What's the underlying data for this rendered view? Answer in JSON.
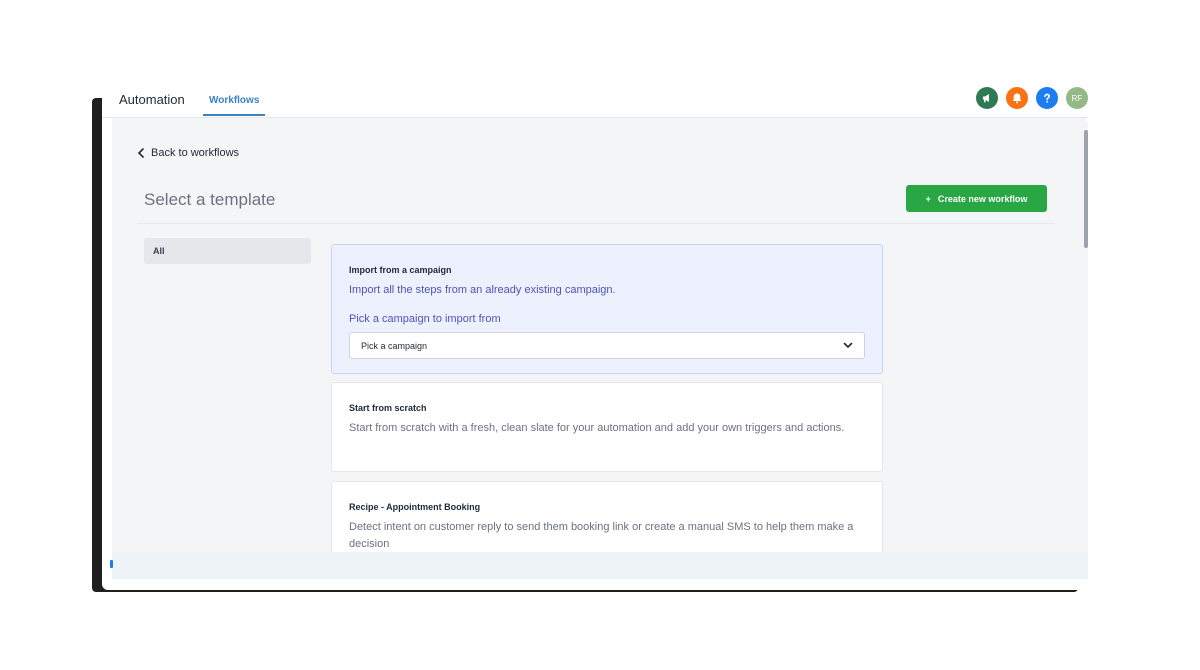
{
  "header": {
    "app_title": "Automation",
    "tab_label": "Workflows",
    "icons": [
      "megaphone-icon",
      "bell-icon",
      "help-icon"
    ],
    "avatar_initials": "RF",
    "colors": {
      "megaphone": "#2f7a55",
      "bell": "#f97316",
      "help": "#1d7cf2",
      "avatar": "#93b986"
    }
  },
  "page": {
    "back_label": "Back to workflows",
    "title": "Select a template",
    "create_button_label": "Create new workflow",
    "accent_color": "#2aa745"
  },
  "sidebar": {
    "items": [
      {
        "label": "All",
        "selected": true
      }
    ]
  },
  "templates": [
    {
      "title": "Import from a campaign",
      "description": "Import all the steps from an already existing campaign.",
      "pick_label": "Pick a campaign to import from",
      "select_value": "Pick a campaign",
      "selected": true
    },
    {
      "title": "Start from scratch",
      "description": "Start from scratch with a fresh, clean slate for your automation and add your own triggers and actions."
    },
    {
      "title": "Recipe - Appointment Booking",
      "description": "Detect intent on customer reply to send them booking link or create a manual SMS to help them make a decision"
    }
  ]
}
